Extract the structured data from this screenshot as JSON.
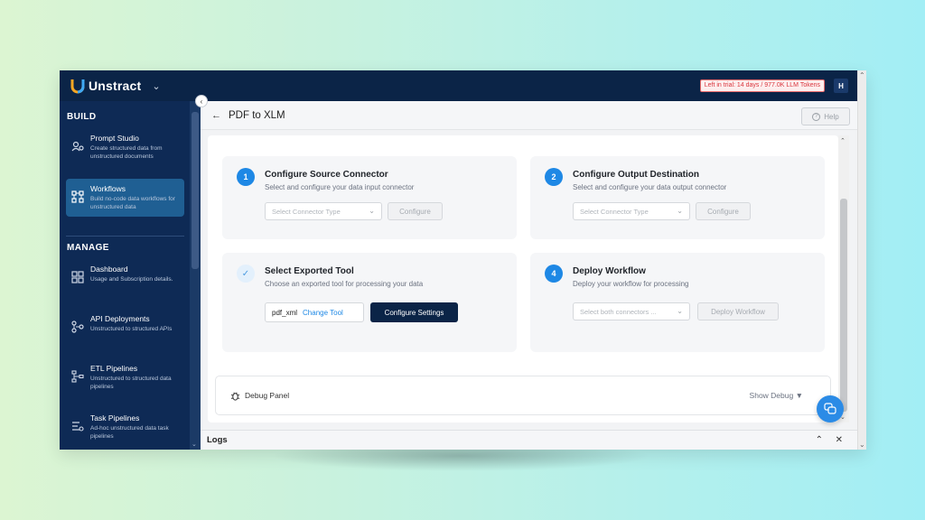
{
  "app": {
    "name": "Unstract",
    "trial_text": "Left in trial: 14 days / 977.0K LLM Tokens",
    "avatar_initial": "H"
  },
  "sidebar": {
    "build_title": "BUILD",
    "manage_title": "MANAGE",
    "build_items": [
      {
        "label": "Prompt Studio",
        "desc": "Create structured data from unstructured documents",
        "icon": "prompt-studio-icon"
      },
      {
        "label": "Workflows",
        "desc": "Build no-code data workflows for unstructured data",
        "icon": "workflows-icon",
        "active": true
      }
    ],
    "manage_items": [
      {
        "label": "Dashboard",
        "desc": "Usage and Subscription details.",
        "icon": "dashboard-icon"
      },
      {
        "label": "API Deployments",
        "desc": "Unstructured to structured APIs",
        "icon": "api-icon"
      },
      {
        "label": "ETL Pipelines",
        "desc": "Unstructured to structured data pipelines",
        "icon": "etl-icon"
      },
      {
        "label": "Task Pipelines",
        "desc": "Ad-hoc unstructured data task pipelines",
        "icon": "task-icon"
      }
    ]
  },
  "header": {
    "title": "PDF to XLM",
    "help_label": "Help"
  },
  "steps": {
    "source": {
      "number": "1",
      "title": "Configure Source Connector",
      "subtitle": "Select and configure your data input connector",
      "select_placeholder": "Select Connector Type",
      "button": "Configure"
    },
    "output": {
      "number": "2",
      "title": "Configure Output Destination",
      "subtitle": "Select and configure your data output connector",
      "select_placeholder": "Select Connector Type",
      "button": "Configure"
    },
    "tool": {
      "title": "Select Exported Tool",
      "subtitle": "Choose an exported tool for processing your data",
      "tool_name": "pdf_xml",
      "change_label": "Change Tool",
      "settings_button": "Configure Settings"
    },
    "deploy": {
      "number": "4",
      "title": "Deploy Workflow",
      "subtitle": "Deploy your workflow for processing",
      "select_placeholder": "Select both connectors ...",
      "button": "Deploy Workflow"
    }
  },
  "debug": {
    "label": "Debug Panel",
    "toggle": "Show Debug ▼"
  },
  "logs": {
    "label": "Logs"
  },
  "colors": {
    "topbar": "#0b2447",
    "sidebar": "#0e2a55",
    "accent": "#1e88e5",
    "active_nav": "#1f5f93"
  }
}
